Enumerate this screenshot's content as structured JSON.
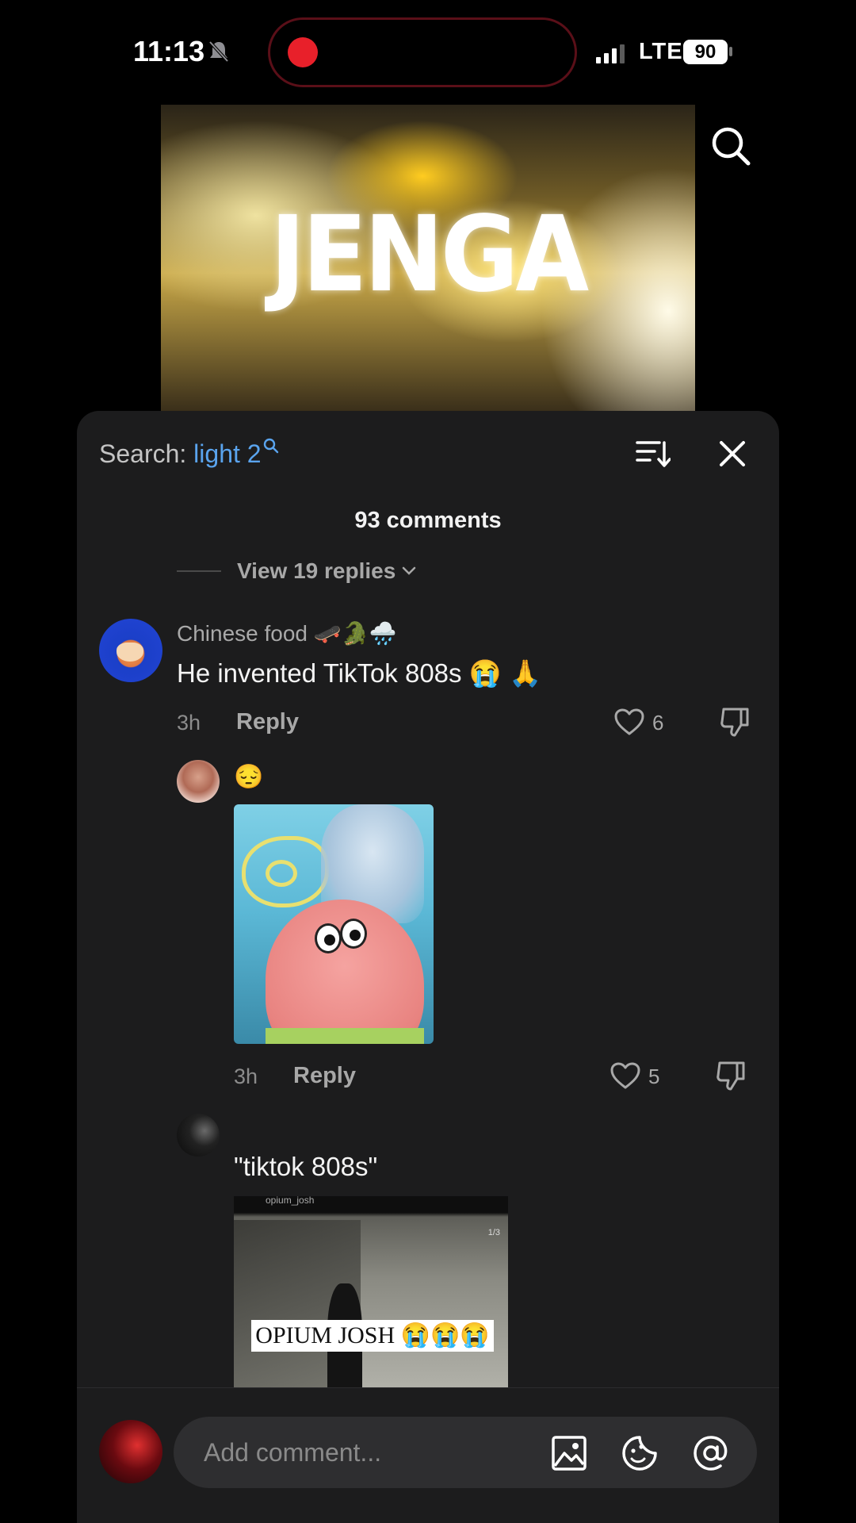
{
  "status_bar": {
    "time": "11:13",
    "network": "LTE",
    "battery": "90"
  },
  "video": {
    "overlay_text": "JENGA"
  },
  "comments_sheet": {
    "search_label": "Search:",
    "search_term": "light 2",
    "count_text": "93 comments",
    "view_replies": "View 19 replies",
    "comment": {
      "username": "Chinese food 🛹🐊🌧️",
      "text": "He invented TikTok 808s 😭 🙏",
      "time": "3h",
      "reply_label": "Reply",
      "likes": "6"
    },
    "reply1": {
      "text": "😔",
      "time": "3h",
      "reply_label": "Reply",
      "likes": "5"
    },
    "reply2": {
      "text": "\"tiktok 808s\"",
      "image_caption": "OPIUM JOSH 😭😭😭",
      "image_username": "opium_josh",
      "image_page": "1/3"
    }
  },
  "input": {
    "placeholder": "Add comment..."
  }
}
